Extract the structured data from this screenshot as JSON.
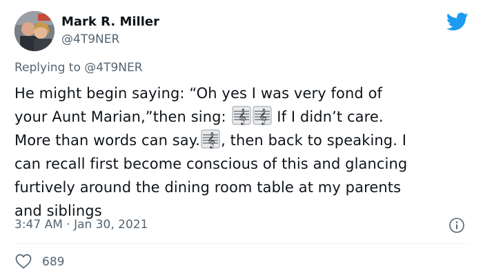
{
  "author": {
    "name": "Mark R. Miller",
    "handle": "@4T9NER"
  },
  "reply": {
    "prefix": "Replying to",
    "handle": "@4T9NER"
  },
  "tweet": {
    "line1": "He might begin saying: “Oh yes I was very fond of",
    "line2_a": "your Aunt Marian,”then sing: ",
    "line2_b": " If I didn’t care.",
    "line3_a": "More than words can say.",
    "line3_b": ", then back to speaking. I",
    "line4": "can recall first become conscious of this and glancing",
    "line5": "furtively around the dining room table at my parents",
    "line6": "and siblings"
  },
  "icons": {
    "music": "musical-score-emoji",
    "logo": "twitter-bird-icon",
    "info": "info-icon",
    "like": "heart-icon"
  },
  "meta": {
    "timestamp": "3:47 AM · Jan 30, 2021",
    "likes": "689"
  },
  "colors": {
    "brand": "#1d9bf0",
    "secondary_text": "#536471",
    "primary_text": "#0f1419",
    "divider": "#eff3f4"
  }
}
